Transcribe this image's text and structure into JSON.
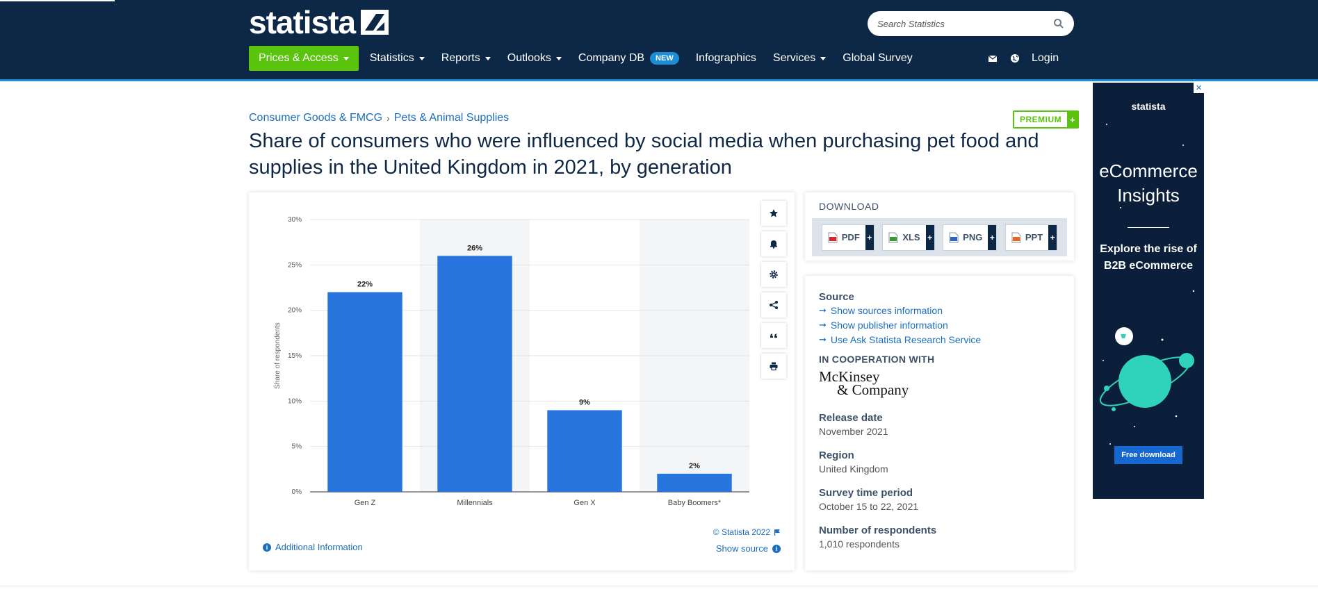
{
  "header": {
    "logo_text": "statista",
    "search_placeholder": "Search Statistics",
    "nav": [
      {
        "label": "Prices & Access",
        "caret": true
      },
      {
        "label": "Statistics",
        "caret": true
      },
      {
        "label": "Reports",
        "caret": true
      },
      {
        "label": "Outlooks",
        "caret": true
      },
      {
        "label": "Company DB",
        "badge": "NEW"
      },
      {
        "label": "Infographics"
      },
      {
        "label": "Services",
        "caret": true
      },
      {
        "label": "Global Survey"
      }
    ],
    "login_label": "Login"
  },
  "breadcrumb": [
    "Consumer Goods & FMCG",
    "Pets & Animal Supplies"
  ],
  "breadcrumb_sep": "›",
  "premium_label": "PREMIUM",
  "premium_plus": "+",
  "title": "Share of consumers who were influenced by social media when purchasing pet food and supplies in the United Kingdom in 2021, by generation",
  "chart_data": {
    "type": "bar",
    "categories": [
      "Gen Z",
      "Millennials",
      "Gen X",
      "Baby Boomers*"
    ],
    "values": [
      22,
      26,
      9,
      2
    ],
    "data_labels": [
      "22%",
      "26%",
      "9%",
      "2%"
    ],
    "ylabel": "Share of respondents",
    "ylim": [
      0,
      30
    ],
    "yticks": [
      "0%",
      "5%",
      "10%",
      "15%",
      "20%",
      "25%",
      "30%"
    ],
    "grid": true,
    "color": "#2876dd"
  },
  "chart_footer": {
    "copyright": "© Statista 2022",
    "additional_info": "Additional Information",
    "show_source": "Show source"
  },
  "download": {
    "title": "DOWNLOAD",
    "buttons": [
      {
        "label": "PDF",
        "icon": "pdf-file-icon",
        "color": "#d9262c"
      },
      {
        "label": "XLS",
        "icon": "xls-file-icon",
        "color": "#3c9a31"
      },
      {
        "label": "PNG",
        "icon": "png-file-icon",
        "color": "#2766c3"
      },
      {
        "label": "PPT",
        "icon": "ppt-file-icon",
        "color": "#e2661d"
      }
    ]
  },
  "info": {
    "source_heading": "Source",
    "source_links": [
      "Show sources information",
      "Show publisher information",
      "Use Ask Statista Research Service"
    ],
    "coop_heading": "IN COOPERATION WITH",
    "coop_logo_line1": "McKinsey",
    "coop_logo_line2": "& Company",
    "fields": [
      {
        "label": "Release date",
        "value": "November 2021"
      },
      {
        "label": "Region",
        "value": "United Kingdom"
      },
      {
        "label": "Survey time period",
        "value": "October 15 to 22, 2021"
      },
      {
        "label": "Number of respondents",
        "value": "1,010 respondents"
      }
    ]
  },
  "ad": {
    "logo": "statista",
    "headline_1": "eCommerce",
    "headline_2": "Insights",
    "sub_1": "Explore the rise of",
    "sub_2": "B2B eCommerce",
    "button": "Free download",
    "close": "✕"
  }
}
